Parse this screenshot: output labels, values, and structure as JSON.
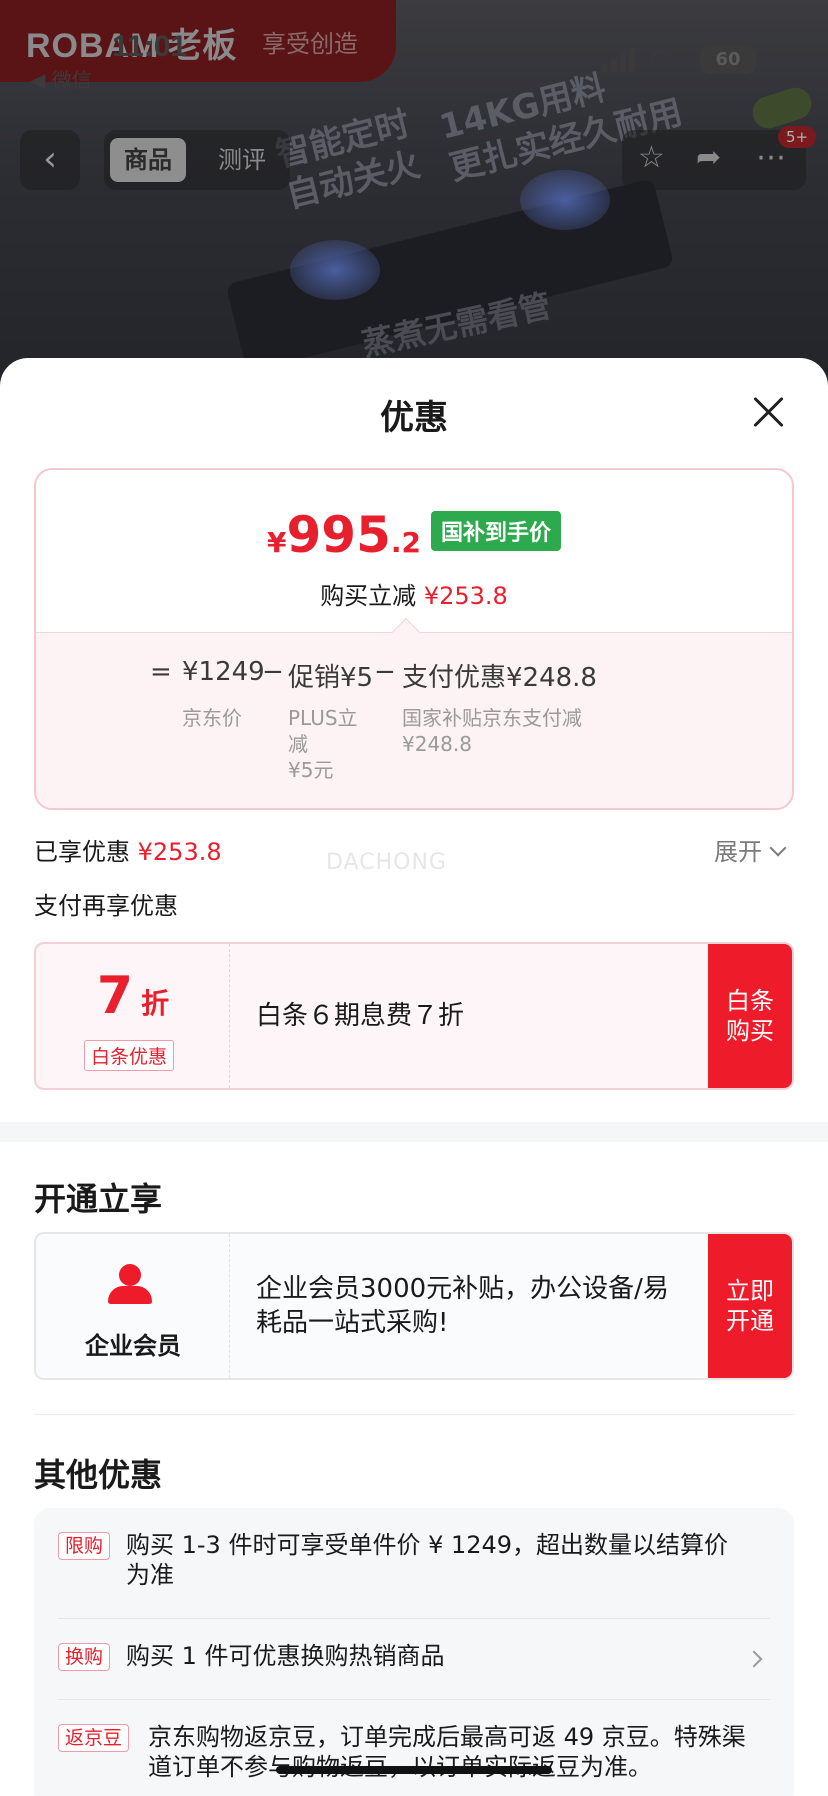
{
  "background": {
    "brand": "ROBAM",
    "brand_cn": "老板",
    "brand_slogan": "享受创造",
    "status_time": "11:01",
    "back_app": "◀ 微信",
    "battery": "60",
    "tabs": [
      "商品",
      "测评"
    ],
    "cart_badge": "5+",
    "hero_text_1": "智能定时\n自动关火",
    "hero_text_2": "14KG用料\n更扎实经久耐用",
    "hero_text_3": "蒸煮无需看管"
  },
  "sheet": {
    "title": "优惠",
    "price": {
      "currency": "¥",
      "integer": "995",
      "decimal": ".2",
      "tag": "国补到手价",
      "instant_cut_label": "购买立减",
      "instant_cut_value": "¥253.8"
    },
    "breakdown": {
      "equals": "=",
      "jd_price": "¥1249",
      "jd_price_label": "京东价",
      "minus1": "−",
      "promo": "促销¥5",
      "promo_label_1": "PLUS立",
      "promo_label_2": "减",
      "promo_label_3": "¥5元",
      "minus2": "−",
      "pay": "支付优惠¥248.8",
      "pay_label_1": "国家补贴京东支付减",
      "pay_label_2": "¥248.8"
    },
    "enjoyed_label": "已享优惠",
    "enjoyed_value": "¥253.8",
    "expand_label": "展开",
    "watermark": "DACHONG",
    "pay_more_title": "支付再享优惠",
    "baitiao": {
      "discount_num": "7",
      "discount_unit": "折",
      "tag": "白条优惠",
      "desc": "白条６期息费７折",
      "button": "白条购买"
    },
    "open_section_title": "开通立享",
    "enterprise": {
      "label": "企业会员",
      "desc": "企业会员3000元补贴，办公设备/易耗品一站式采购!",
      "button": "立即开通"
    },
    "other_title": "其他优惠",
    "other_items": [
      {
        "tag": "限购",
        "text": "购买 1-3 件时可享受单件价 ¥ 1249，超出数量以结算价为准"
      },
      {
        "tag": "换购",
        "text": "购买 1 件可优惠换购热销商品"
      },
      {
        "tag": "返京豆",
        "text": "京东购物返京豆，订单完成后最高可返 49 京豆。特殊渠道订单不参与购物返豆，以订单实际返豆为准。"
      }
    ]
  },
  "colors": {
    "accent_red": "#e8202e",
    "button_red": "#ee1c2b",
    "subsidy_green": "#2eaa4e"
  }
}
